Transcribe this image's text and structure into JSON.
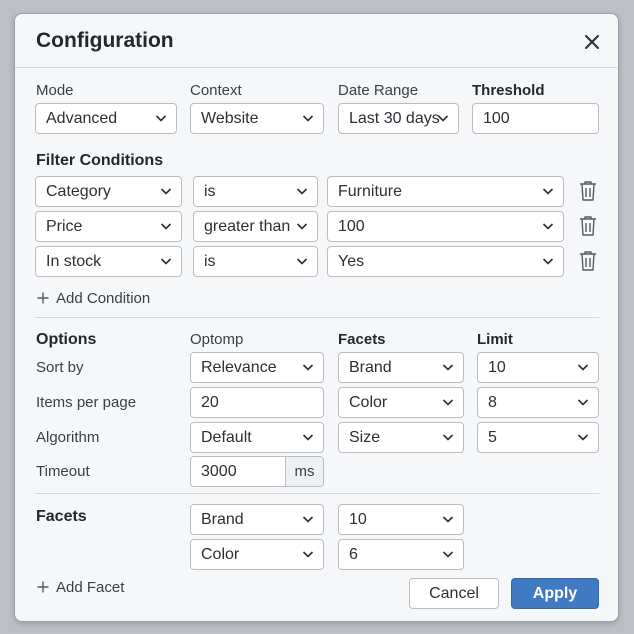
{
  "dialog": {
    "title": "Configuration"
  },
  "top": {
    "mode": {
      "label": "Mode",
      "value": "Advanced"
    },
    "context": {
      "label": "Context",
      "value": "Website"
    },
    "date_range": {
      "label": "Date Range",
      "value": "Last 30 days"
    },
    "threshold": {
      "label": "Threshold",
      "value": "100"
    }
  },
  "filters": {
    "heading": "Filter Conditions",
    "rows": [
      {
        "field": "Category",
        "operator": "is",
        "value": "Furniture"
      },
      {
        "field": "Price",
        "operator": "greater than",
        "value": "100"
      },
      {
        "field": "In stock",
        "operator": "is",
        "value": "Yes"
      }
    ],
    "add_label": "Add Condition"
  },
  "options": {
    "heading": "Options",
    "col_optomp": "Optomp",
    "col_facets": "Facets",
    "col_limit": "Limit",
    "rows": [
      {
        "label": "Sort by",
        "option": "Relevance",
        "facet": "Brand",
        "limit": "10"
      },
      {
        "label": "Items per page",
        "option": "20",
        "facet": "Color",
        "limit": "8"
      },
      {
        "label": "Algorithm",
        "option": "Default",
        "facet": "Size",
        "limit": "5"
      }
    ],
    "timeout": {
      "label": "Timeout",
      "value": "3000",
      "unit": "ms"
    }
  },
  "facets": {
    "heading": "Facets",
    "rows": [
      {
        "facet": "Brand",
        "value": "10"
      },
      {
        "facet": "Color",
        "value": "6"
      }
    ],
    "add_label": "Add Facet"
  },
  "footer": {
    "cancel_label": "Cancel",
    "apply_label": "Apply"
  },
  "colors": {
    "accent": "#3f7ac2",
    "background": "#f6f7f8",
    "border": "#b9bec5"
  },
  "icons": {
    "close": "close-icon",
    "dropdown": "chevron-down-icon",
    "delete": "trash-icon",
    "add": "plus-icon"
  }
}
